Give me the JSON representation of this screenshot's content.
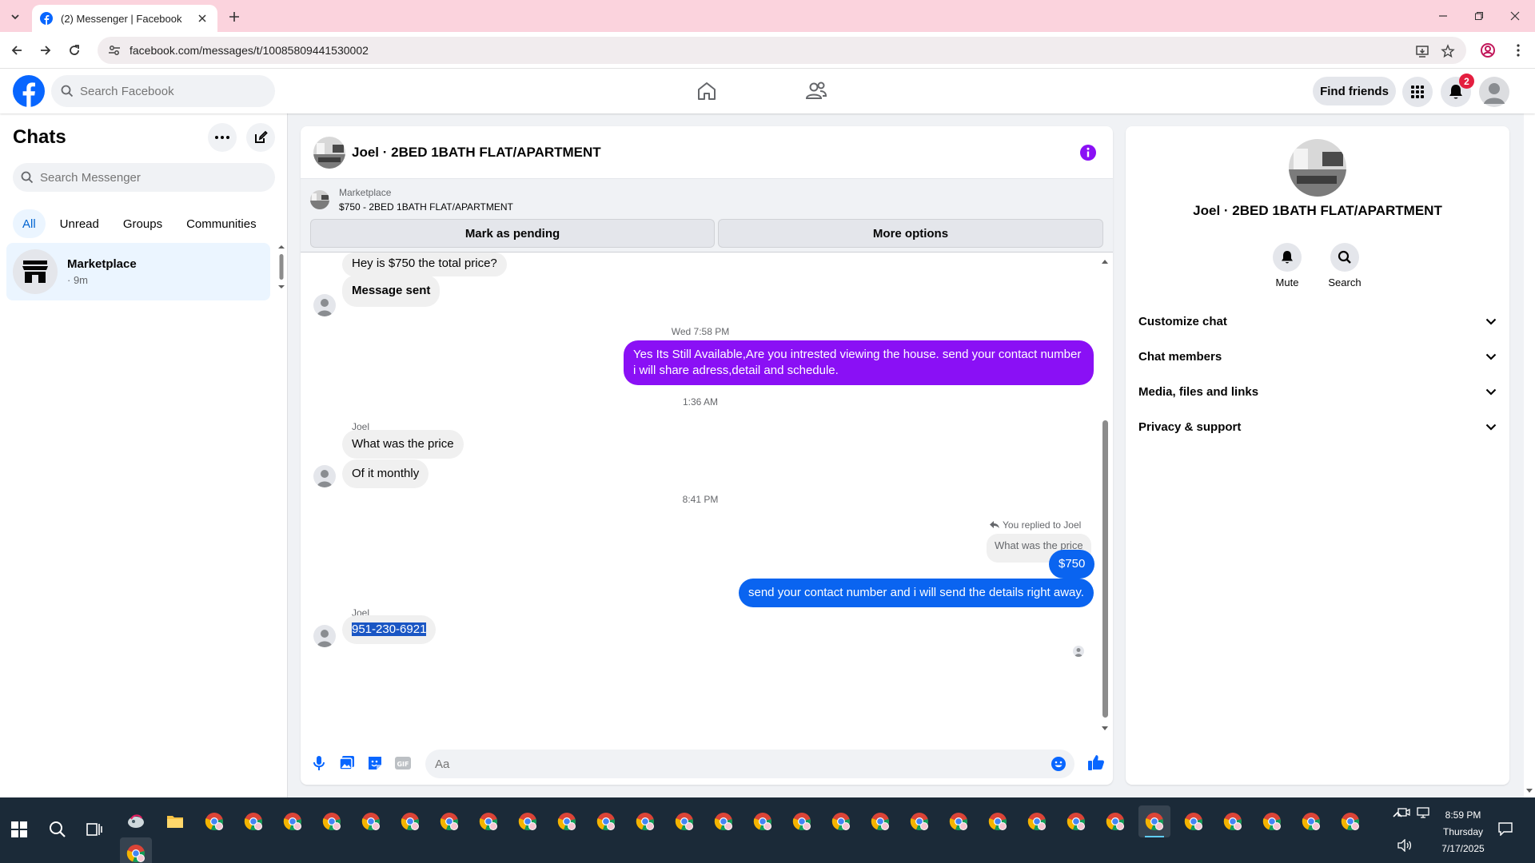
{
  "browser": {
    "tab_title": "(2) Messenger | Facebook",
    "url": "facebook.com/messages/t/10085809441530002"
  },
  "fb": {
    "search_placeholder": "Search Facebook",
    "find_friends": "Find friends",
    "notif_count": "2",
    "brand_color": "#0866ff"
  },
  "chats": {
    "title": "Chats",
    "search_placeholder": "Search Messenger",
    "filters": [
      "All",
      "Unread",
      "Groups",
      "Communities"
    ],
    "items": [
      {
        "name": "Marketplace",
        "time": "· 9m"
      }
    ]
  },
  "conversation": {
    "title": "Joel · 2BED 1BATH FLAT/APARTMENT",
    "marketplace_label": "Marketplace",
    "listing": "$750 - 2BED 1BATH FLAT/APARTMENT",
    "mark_pending": "Mark as pending",
    "more_options": "More options",
    "messages": {
      "m1": "Hey is $750 the total price?",
      "m2": "Message sent",
      "ts1": "Wed 7:58 PM",
      "m3": "Yes Its Still Available,Are you intrested viewing the house. send your contact number i will share adress,detail and schedule.",
      "ts2": "1:36 AM",
      "sender1": "Joel",
      "m4": "What was the price",
      "m5": "Of it monthly",
      "ts3": "8:41 PM",
      "reply_note": "You replied to Joel",
      "reply_quote": "What was the price",
      "m6": "$750",
      "m7": "send your contact number and i will send the details right away.",
      "sender2": "Joel",
      "m8": "951-230-6921"
    },
    "composer_placeholder": "Aa"
  },
  "info": {
    "name": "Joel · 2BED 1BATH FLAT/APARTMENT",
    "mute": "Mute",
    "search": "Search",
    "sections": [
      "Customize chat",
      "Chat members",
      "Media, files and links",
      "Privacy & support"
    ]
  },
  "taskbar": {
    "time": "8:59 PM",
    "day": "Thursday",
    "date": "7/17/2025"
  }
}
